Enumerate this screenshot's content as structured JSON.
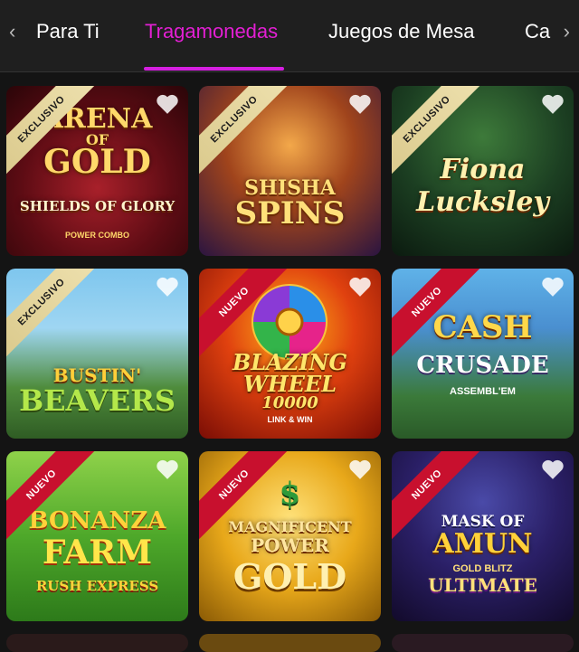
{
  "tabs": {
    "items": [
      {
        "label": "Para Ti"
      },
      {
        "label": "Tragamonedas"
      },
      {
        "label": "Juegos de Mesa"
      },
      {
        "label": "Ca"
      }
    ],
    "active": "Tragamonedas"
  },
  "games": [
    {
      "badge": "EXCLUSIVO",
      "title_lines": [
        "ARENA",
        "OF",
        "GOLD"
      ],
      "subtitle": "SHIELDS OF GLORY",
      "tagline": "POWER COMBO"
    },
    {
      "badge": "EXCLUSIVO",
      "title_lines": [
        "SHISHA",
        "SPINS"
      ],
      "subtitle": "",
      "tagline": ""
    },
    {
      "badge": "EXCLUSIVO",
      "title_lines": [
        "Fiona",
        "Lucksley"
      ],
      "subtitle": "",
      "tagline": ""
    },
    {
      "badge": "EXCLUSIVO",
      "title_lines": [
        "BUSTIN'",
        "BEAVERS"
      ],
      "subtitle": "",
      "tagline": ""
    },
    {
      "badge": "NUEVO",
      "title_lines": [
        "BLAZING",
        "WHEEL",
        "10000"
      ],
      "subtitle": "LINK & WIN",
      "tagline": ""
    },
    {
      "badge": "NUEVO",
      "title_lines": [
        "CASH",
        "CRUSADE"
      ],
      "subtitle": "ASSEMBL'EM",
      "tagline": ""
    },
    {
      "badge": "NUEVO",
      "title_lines": [
        "BONANZA",
        "FARM"
      ],
      "subtitle": "RUSH EXPRESS",
      "tagline": ""
    },
    {
      "badge": "NUEVO",
      "title_lines": [
        "MAGNIFICENT",
        "POWER",
        "GOLD"
      ],
      "subtitle": "",
      "tagline": ""
    },
    {
      "badge": "NUEVO",
      "title_lines": [
        "MASK OF",
        "AMUN"
      ],
      "subtitle": "GOLD BLITZ",
      "tagline": "ULTIMATE"
    }
  ],
  "colors": {
    "accent": "#d51fe0",
    "ribbon_new": "#c8102e",
    "ribbon_exclusive": "#e6d9a2",
    "background": "#141414"
  }
}
